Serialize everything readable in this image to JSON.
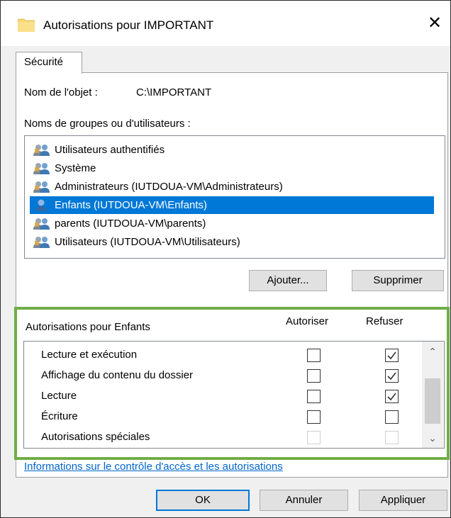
{
  "window": {
    "title": "Autorisations pour IMPORTANT",
    "close_glyph": "✕",
    "folder_color": "#f8d775"
  },
  "tabs": [
    {
      "label": "Sécurité",
      "active": true
    }
  ],
  "object": {
    "label": "Nom de l'objet :",
    "value": "C:\\IMPORTANT"
  },
  "groups": {
    "label": "Noms de groupes ou d'utilisateurs :",
    "items": [
      {
        "label": "Utilisateurs authentifiés",
        "icon": "users-group-icon",
        "selected": false
      },
      {
        "label": "Système",
        "icon": "users-group-icon",
        "selected": false
      },
      {
        "label": "Administrateurs (IUTDOUA-VM\\Administrateurs)",
        "icon": "users-group-icon",
        "selected": false
      },
      {
        "label": "Enfants (IUTDOUA-VM\\Enfants)",
        "icon": "single-user-icon",
        "selected": true
      },
      {
        "label": "parents (IUTDOUA-VM\\parents)",
        "icon": "users-group-icon",
        "selected": false
      },
      {
        "label": "Utilisateurs (IUTDOUA-VM\\Utilisateurs)",
        "icon": "users-group-icon",
        "selected": false
      }
    ],
    "selection_color": "#0078d7"
  },
  "buttons": {
    "add": "Ajouter...",
    "remove": "Supprimer",
    "ok": "OK",
    "cancel": "Annuler",
    "apply": "Appliquer"
  },
  "permissions": {
    "title": "Autorisations pour Enfants",
    "col_allow": "Autoriser",
    "col_deny": "Refuser",
    "rows": [
      {
        "name": "Lecture et exécution",
        "allow": false,
        "deny": true,
        "disabled": false
      },
      {
        "name": "Affichage du contenu du dossier",
        "allow": false,
        "deny": true,
        "disabled": false
      },
      {
        "name": "Lecture",
        "allow": false,
        "deny": true,
        "disabled": false
      },
      {
        "name": "Écriture",
        "allow": false,
        "deny": false,
        "disabled": false
      },
      {
        "name": "Autorisations spéciales",
        "allow": false,
        "deny": false,
        "disabled": true
      }
    ],
    "highlight_color": "#70ad47"
  },
  "link": {
    "label": "Informations sur le contrôle d'accès et les autorisations",
    "color": "#0066cc"
  }
}
